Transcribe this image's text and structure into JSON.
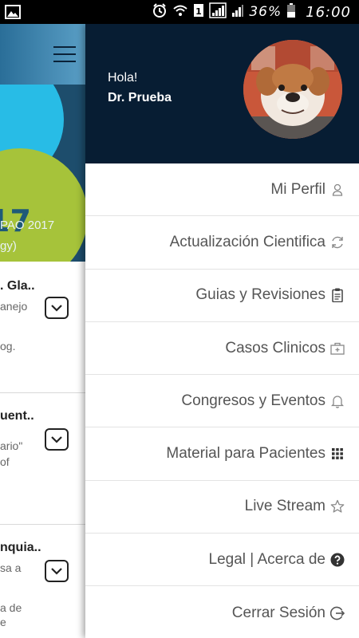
{
  "status_bar": {
    "battery_percent": "36%",
    "time": "16:00"
  },
  "background": {
    "banner_line1": "PAO 2017",
    "banner_line2": "gy)",
    "banner_big": "17",
    "cards": [
      {
        "title": ". Gla..",
        "lines": [
          "anejo",
          "",
          "og."
        ]
      },
      {
        "title": "uent..",
        "lines": [
          "ario\"",
          "of",
          ""
        ]
      },
      {
        "title": "nquia..",
        "lines": [
          "sa a",
          "",
          "a de",
          "e"
        ]
      }
    ]
  },
  "drawer": {
    "greeting": "Hola!",
    "doctor_name": "Dr. Prueba",
    "menu_items": [
      {
        "label": "Mi Perfil",
        "icon": "user-icon"
      },
      {
        "label": "Actualización Cientifica",
        "icon": "refresh-icon"
      },
      {
        "label": "Guias y Revisiones",
        "icon": "clipboard-icon"
      },
      {
        "label": "Casos Clinicos",
        "icon": "medical-kit-icon"
      },
      {
        "label": "Congresos y Eventos",
        "icon": "bell-icon"
      },
      {
        "label": "Material para Pacientes",
        "icon": "grid-icon"
      },
      {
        "label": "Live Stream",
        "icon": "star-icon"
      },
      {
        "label": "Legal | Acerca de",
        "icon": "question-icon"
      },
      {
        "label": "Cerrar Sesión",
        "icon": "logout-icon"
      }
    ]
  }
}
